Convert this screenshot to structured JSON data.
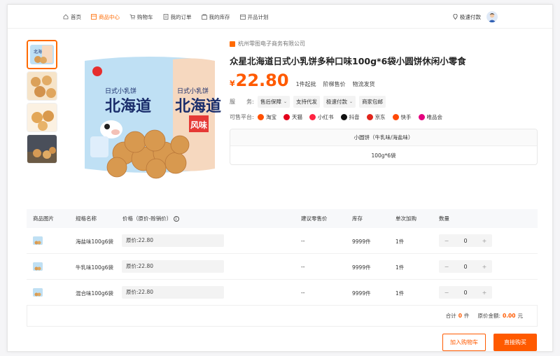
{
  "nav": {
    "items": [
      {
        "label": "首页",
        "icon": "home-icon",
        "active": false
      },
      {
        "label": "商品中心",
        "icon": "grid-icon",
        "active": true
      },
      {
        "label": "购物车",
        "icon": "cart-icon",
        "active": false
      },
      {
        "label": "我的订单",
        "icon": "order-icon",
        "active": false
      },
      {
        "label": "我的库存",
        "icon": "stock-icon",
        "active": false
      },
      {
        "label": "开品计划",
        "icon": "calendar-icon",
        "active": false
      }
    ],
    "fast_pay": "极速付款"
  },
  "product": {
    "shop": "杭州零图电子商务有限公司",
    "title": "众星北海道日式小乳饼多种口味100g*6袋小圆饼休闲小零食",
    "currency": "¥",
    "price": "22.80",
    "min_order": "1件起批",
    "tier_price": "阶梯售价",
    "shipping": "物流发货",
    "service_label": "服　　务:",
    "services": [
      "售后保障",
      "支持代发",
      "极速付款",
      "商家包邮"
    ],
    "platform_label": "可售平台:",
    "platforms": [
      {
        "name": "淘宝",
        "color": "#ff5000"
      },
      {
        "name": "天猫",
        "color": "#e3001b"
      },
      {
        "name": "小红书",
        "color": "#ff2442"
      },
      {
        "name": "抖音",
        "color": "#111111"
      },
      {
        "name": "京东",
        "color": "#e1251b"
      },
      {
        "name": "快手",
        "color": "#ff4906"
      },
      {
        "name": "唯品会",
        "color": "#e4007f"
      }
    ],
    "spec_head": "小圆饼（牛乳味/海盐味）",
    "spec_value": "100g*6袋",
    "image_text": {
      "brand": "北海道",
      "sub": "日式小乳饼",
      "flavor": "风味"
    }
  },
  "table": {
    "headers": [
      "商品图片",
      "规格名称",
      "价格（原价-赊销价）",
      "建议零售价",
      "库存",
      "单次加购",
      "数量"
    ],
    "rows": [
      {
        "name": "海盐味100g6袋",
        "price": "原价:22.80",
        "retail": "--",
        "stock": "9999件",
        "per": "1件",
        "qty": "0"
      },
      {
        "name": "牛乳味100g6袋",
        "price": "原价:22.80",
        "retail": "--",
        "stock": "9999件",
        "per": "1件",
        "qty": "0"
      },
      {
        "name": "混合味100g6袋",
        "price": "原价:22.80",
        "retail": "--",
        "stock": "9999件",
        "per": "1件",
        "qty": "0"
      }
    ],
    "summary": {
      "total_label": "合计",
      "total_count": "0",
      "unit": "件",
      "amount_label": "原价金额:",
      "amount": "0.00",
      "amount_unit": "元"
    }
  },
  "buttons": {
    "add_cart": "加入购物车",
    "buy_now": "直接购买"
  },
  "colors": {
    "accent": "#ff5a00"
  }
}
